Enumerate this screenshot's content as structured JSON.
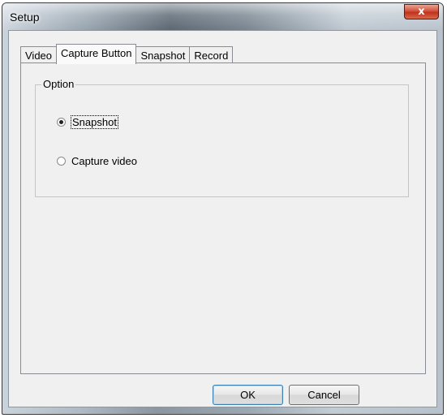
{
  "window": {
    "title": "Setup",
    "close_glyph": "x"
  },
  "tabs": [
    {
      "label": "Video",
      "active": false
    },
    {
      "label": "Capture Button",
      "active": true
    },
    {
      "label": "Snapshot",
      "active": false
    },
    {
      "label": "Record",
      "active": false
    }
  ],
  "option_group": {
    "title": "Option",
    "options": [
      {
        "label": "Snapshot",
        "checked": true
      },
      {
        "label": "Capture video",
        "checked": false
      }
    ]
  },
  "buttons": {
    "ok_label": "OK",
    "cancel_label": "Cancel"
  }
}
